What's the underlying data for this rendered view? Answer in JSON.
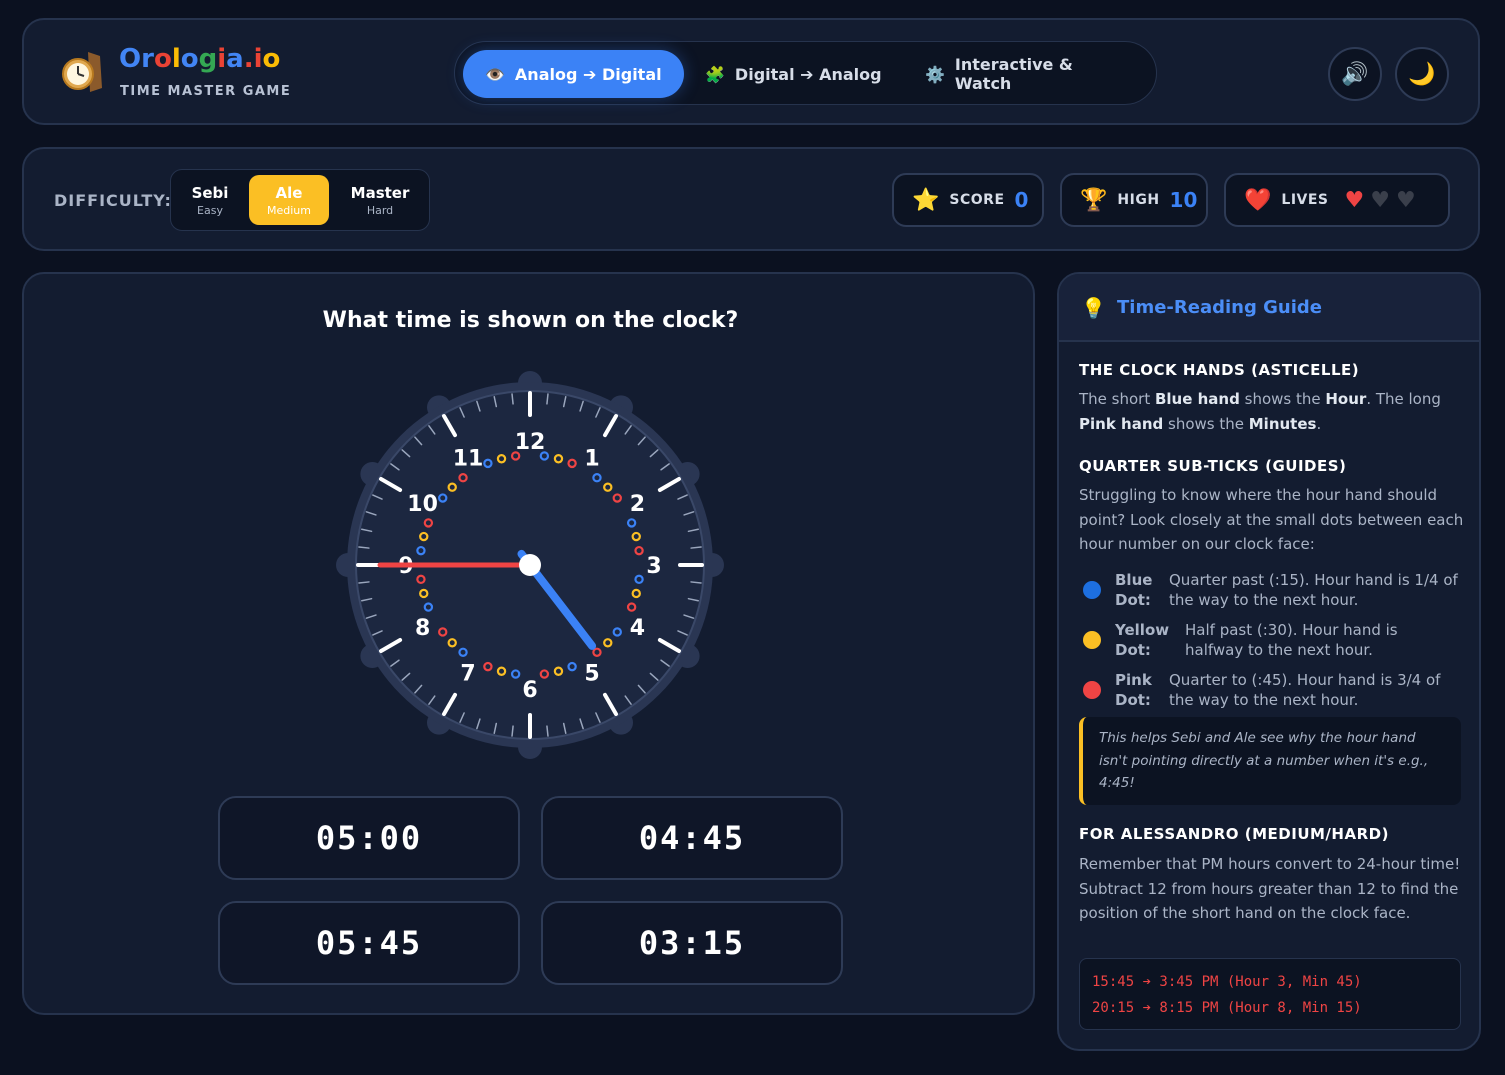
{
  "header": {
    "logo_parts": [
      "Or",
      "o",
      "l",
      "o",
      "g",
      "i",
      "a",
      ".i",
      "o"
    ],
    "subtitle": "TIME MASTER GAME",
    "tabs": [
      {
        "icon": "👁️",
        "label": "Analog ➔ Digital",
        "active": true
      },
      {
        "icon": "🧩",
        "label": "Digital ➔ Analog",
        "active": false
      },
      {
        "icon": "⚙️",
        "label": "Interactive & Watch",
        "active": false
      }
    ],
    "sound_icon": "🔊",
    "theme_icon": "🌙"
  },
  "toolbar": {
    "difficulty_label": "DIFFICULTY:",
    "levels": [
      {
        "name": "Sebi",
        "sub": "Easy",
        "active": false
      },
      {
        "name": "Ale",
        "sub": "Medium",
        "active": true
      },
      {
        "name": "Master",
        "sub": "Hard",
        "active": false
      }
    ],
    "score": {
      "icon": "⭐",
      "label": "SCORE",
      "value": "0"
    },
    "high": {
      "icon": "🏆",
      "label": "HIGH",
      "value": "10"
    },
    "lives": {
      "icon": "❤️",
      "label": "LIVES",
      "hearts": [
        "full",
        "empty",
        "empty"
      ]
    }
  },
  "game": {
    "question": "What time is shown on the clock?",
    "clock": {
      "numbers": [
        "12",
        "1",
        "2",
        "3",
        "4",
        "5",
        "6",
        "7",
        "8",
        "9",
        "10",
        "11"
      ],
      "hour_hand_value": 4.75,
      "minute_hand_value": 45,
      "colors": {
        "hour": "#3b82f6",
        "minute": "#ef4444",
        "dot_blue": "#3b82f6",
        "dot_yellow": "#fbbf24",
        "dot_red": "#ef4444"
      }
    },
    "answers": [
      "05:00",
      "04:45",
      "05:45",
      "03:15"
    ]
  },
  "guide": {
    "title_icon": "💡",
    "title": "Time-Reading Guide",
    "s1_heading": "THE CLOCK HANDS (ASTICELLE)",
    "s1_p": {
      "a": "The short ",
      "b": "Blue hand",
      "c": " shows the ",
      "d": "Hour",
      "e": ". The long ",
      "f": "Pink hand",
      "g": " shows the ",
      "h": "Minutes",
      "i": "."
    },
    "s2_heading": "QUARTER SUB-TICKS (GUIDES)",
    "s2_p": "Struggling to know where the hour hand should point? Look closely at the small dots between each hour number on our clock face:",
    "dots": [
      {
        "color": "#1d6fe0",
        "key1": "Blue",
        "key2": "Dot:",
        "v1": "Quarter past (:15). Hour hand is 1/4 of",
        "v2": "the way to the next hour."
      },
      {
        "color": "#fbbf24",
        "key1": "Yellow",
        "key2": "Dot:",
        "v1": "Half past (:30). Hour hand is",
        "v2": "halfway to the next hour."
      },
      {
        "color": "#ef4444",
        "key1": "Pink",
        "key2": "Dot:",
        "v1": "Quarter to (:45). Hour hand is 3/4 of",
        "v2": "the way to the next hour."
      }
    ],
    "note": "This helps Sebi and Ale see why the hour hand isn't pointing directly at a number when it's e.g., 4:45!",
    "s3_heading": "FOR ALESSANDRO (MEDIUM/HARD)",
    "s3_p": "Remember that PM hours convert to 24-hour time! Subtract 12 from hours greater than 12 to find the position of the short hand on the clock face.",
    "code": [
      "15:45 ➔ 3:45 PM (Hour 3, Min 45)",
      "20:15 ➔ 8:15 PM (Hour 8, Min 15)"
    ]
  }
}
